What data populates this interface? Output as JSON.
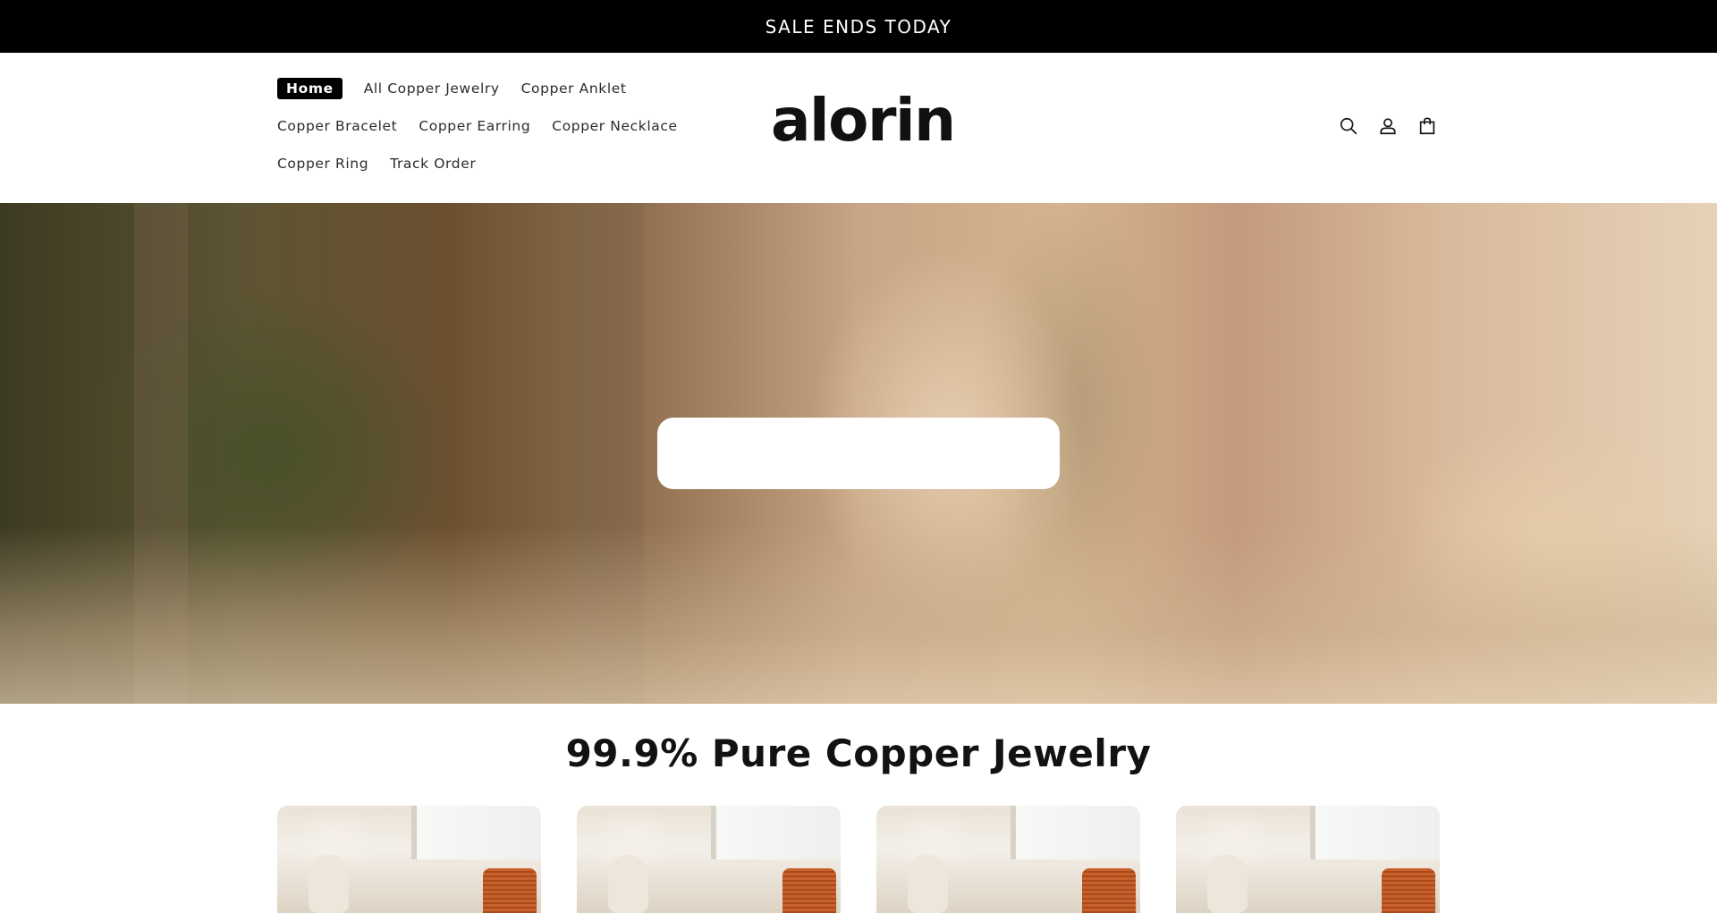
{
  "announcement": {
    "text": "SALE ENDS TODAY"
  },
  "header": {
    "logo_text": "alorin",
    "nav": {
      "row1": [
        "Home",
        "All Copper Jewelry",
        "Copper Anklet"
      ],
      "row2": [
        "Copper Bracelet",
        "Copper Earring",
        "Copper Necklace"
      ],
      "row3": [
        "Copper Ring",
        "Track Order"
      ]
    },
    "icons": [
      "search-icon",
      "account-icon",
      "cart-icon"
    ]
  },
  "hero": {
    "card_text": ""
  },
  "collection": {
    "title": "99.9% Pure Copper Jewelry"
  },
  "colors": {
    "announcement_bg": "#000000",
    "active_nav_bg": "#000000",
    "text": "#121212"
  }
}
